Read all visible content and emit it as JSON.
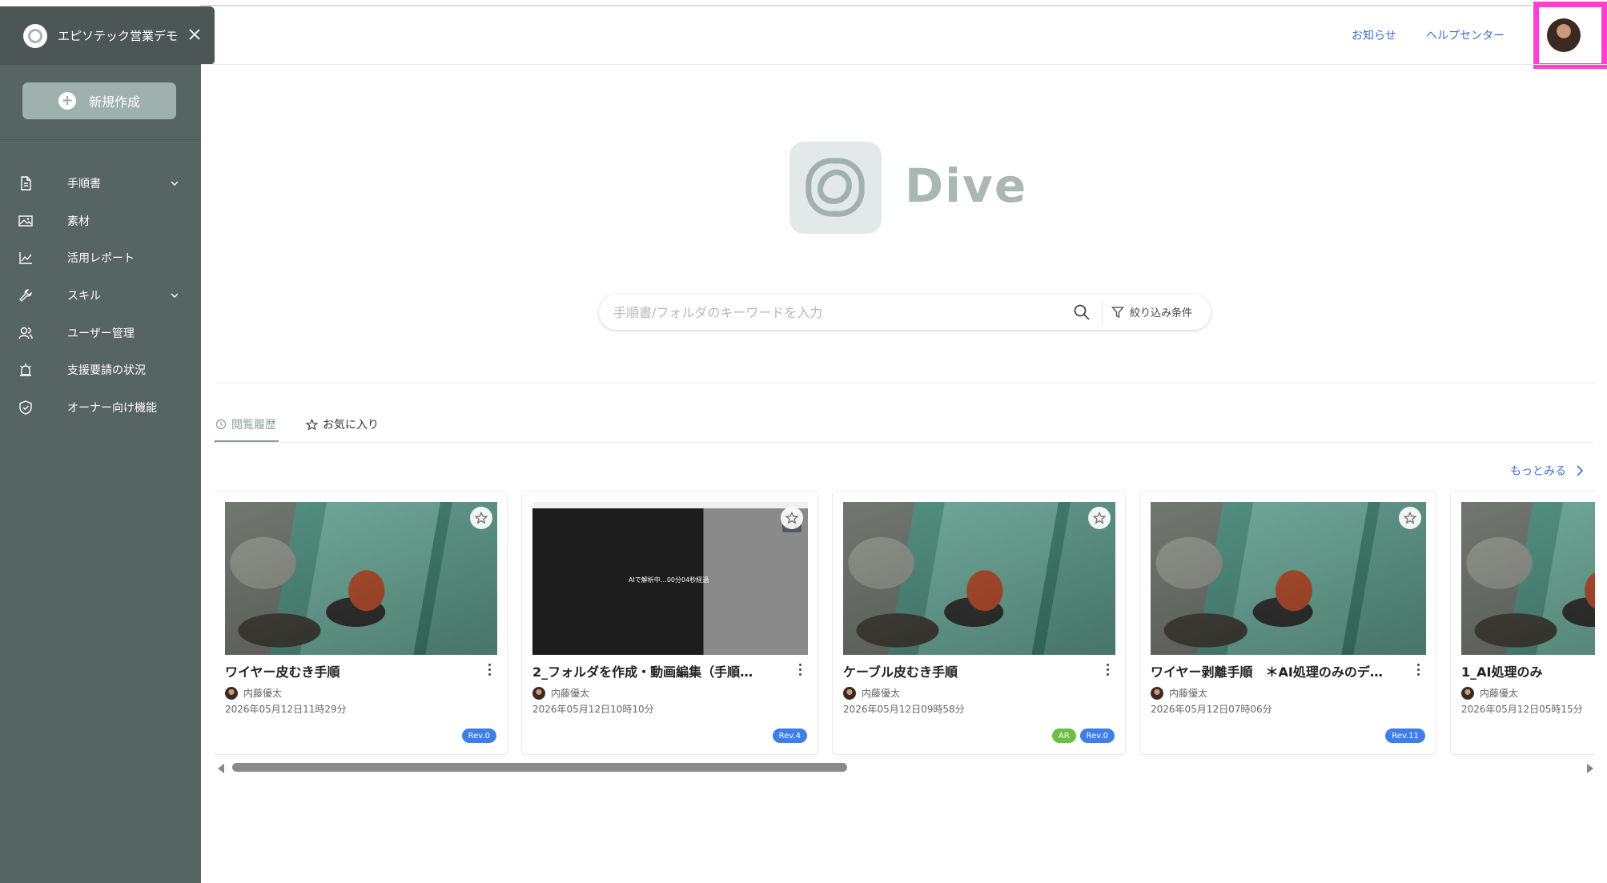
{
  "sidebar": {
    "org_name": "エピソテック営業デモ",
    "new_button_label": "新規作成",
    "items": [
      {
        "label": "手順書",
        "icon": "document-icon",
        "has_chevron": true
      },
      {
        "label": "素材",
        "icon": "image-icon",
        "has_chevron": false
      },
      {
        "label": "活用レポート",
        "icon": "chart-line-icon",
        "has_chevron": false
      },
      {
        "label": "スキル",
        "icon": "wrench-icon",
        "has_chevron": true
      },
      {
        "label": "ユーザー管理",
        "icon": "users-icon",
        "has_chevron": false
      },
      {
        "label": "支援要請の状況",
        "icon": "alarm-icon",
        "has_chevron": false
      },
      {
        "label": "オーナー向け機能",
        "icon": "shield-icon",
        "has_chevron": false
      }
    ]
  },
  "header": {
    "news_link": "お知らせ",
    "help_link": "ヘルプセンター"
  },
  "brand": {
    "name": "Dive"
  },
  "search": {
    "placeholder": "手順書/フォルダのキーワードを入力",
    "filter_label": "絞り込み条件"
  },
  "tabs": [
    {
      "label": "閲覧履歴",
      "active": true
    },
    {
      "label": "お気に入り",
      "active": false
    }
  ],
  "more_label": "もっとみる",
  "cards": [
    {
      "title": "ワイヤー皮むき手順",
      "author": "内藤優太",
      "date": "2026年05月12日11時29分",
      "badges": [
        "Rev.0"
      ],
      "thumb": "photo"
    },
    {
      "title": "2_フォルダを作成・動画編集（手順…",
      "author": "内藤優太",
      "date": "2026年05月12日10時10分",
      "badges": [
        "Rev.4"
      ],
      "thumb": "screen",
      "overlay": "AIで解析中…00分04秒経過"
    },
    {
      "title": "ケーブル皮むき手順",
      "author": "内藤優太",
      "date": "2026年05月12日09時58分",
      "badges": [
        "AR",
        "Rev.0"
      ],
      "thumb": "photo"
    },
    {
      "title": "ワイヤー剥離手順　＊AI処理のみのデ…",
      "author": "内藤優太",
      "date": "2026年05月12日07時06分",
      "badges": [
        "Rev.11"
      ],
      "thumb": "photo"
    },
    {
      "title": "1_AI処理のみ",
      "author": "内藤優太",
      "date": "2026年05月12日05時15分",
      "badges": [],
      "thumb": "photo"
    }
  ],
  "colors": {
    "sidebar_bg": "#576562",
    "accent_link": "#3d6fd0",
    "highlight_box": "#ff3fd2",
    "badge_rev": "#3f7ee8",
    "badge_ar": "#6cbe45"
  }
}
